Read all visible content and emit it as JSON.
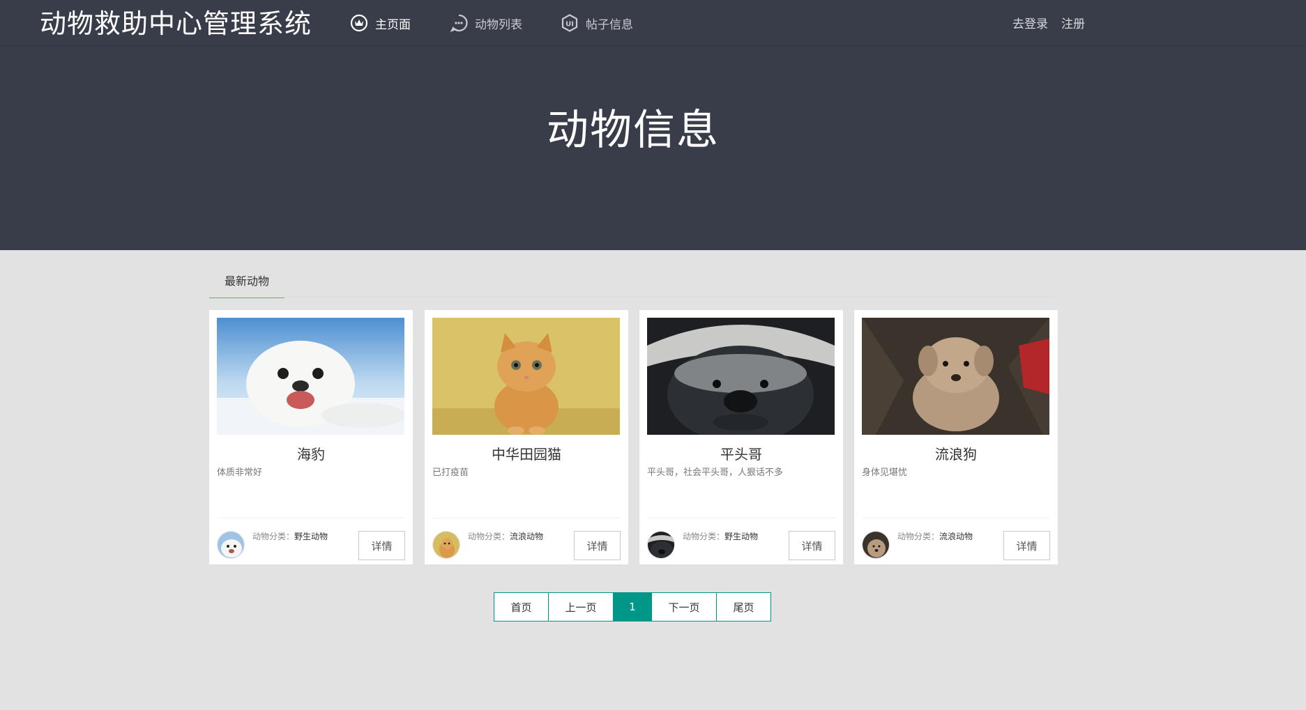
{
  "brand": "动物救助中心管理系统",
  "nav": {
    "items": [
      {
        "label": "主页面",
        "icon": "home-icon"
      },
      {
        "label": "动物列表",
        "icon": "chat-icon"
      },
      {
        "label": "帖子信息",
        "icon": "ui-icon"
      }
    ],
    "login": "去登录",
    "register": "注册"
  },
  "hero": {
    "title": "动物信息"
  },
  "section": {
    "tab": "最新动物"
  },
  "category_label": "动物分类：",
  "detail_label": "详情",
  "cards": [
    {
      "name": "海豹",
      "desc": "体质非常好",
      "category": "野生动物"
    },
    {
      "name": "中华田园猫",
      "desc": "已打疫苗",
      "category": "流浪动物"
    },
    {
      "name": "平头哥",
      "desc": "平头哥，社会平头哥，人狠话不多",
      "category": "野生动物"
    },
    {
      "name": "流浪狗",
      "desc": "身体见堪忧",
      "category": "流浪动物"
    }
  ],
  "pagination": {
    "first": "首页",
    "prev": "上一页",
    "current": "1",
    "next": "下一页",
    "last": "尾页"
  },
  "colors": {
    "nav_bg": "#393d49",
    "accent_green": "#5fb878",
    "teal": "#009688"
  }
}
